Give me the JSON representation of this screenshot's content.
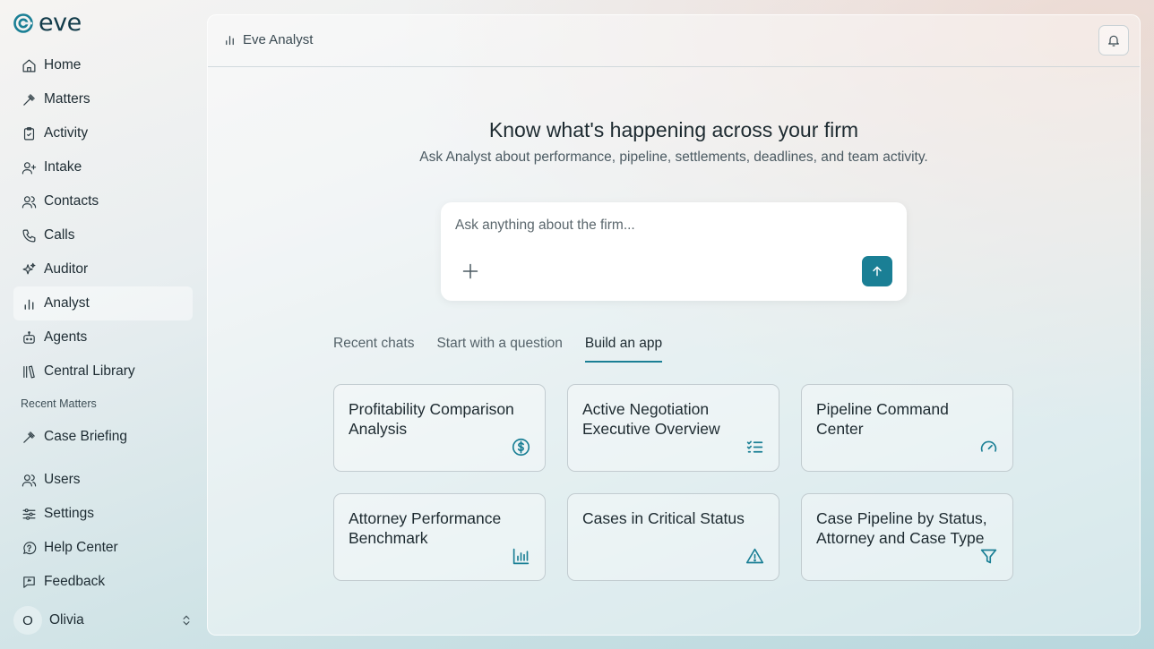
{
  "app": {
    "logo_text": "eve"
  },
  "sidebar": {
    "items": [
      {
        "label": "Home",
        "icon": "home-icon"
      },
      {
        "label": "Matters",
        "icon": "gavel-icon"
      },
      {
        "label": "Activity",
        "icon": "clipboard-check-icon"
      },
      {
        "label": "Intake",
        "icon": "user-plus-icon"
      },
      {
        "label": "Contacts",
        "icon": "users-icon"
      },
      {
        "label": "Calls",
        "icon": "phone-icon"
      },
      {
        "label": "Auditor",
        "icon": "sparkles-icon"
      },
      {
        "label": "Analyst",
        "icon": "bar-chart-icon",
        "active": true
      },
      {
        "label": "Agents",
        "icon": "bot-icon"
      },
      {
        "label": "Central Library",
        "icon": "library-icon"
      }
    ],
    "recent_section_label": "Recent Matters",
    "recent_items": [
      {
        "label": "Case Briefing",
        "icon": "gavel-icon"
      }
    ],
    "bottom_items": [
      {
        "label": "Users",
        "icon": "users-icon"
      },
      {
        "label": "Settings",
        "icon": "sliders-icon"
      },
      {
        "label": "Help Center",
        "icon": "help-circle-icon"
      },
      {
        "label": "Feedback",
        "icon": "feedback-icon"
      }
    ],
    "user": {
      "initial": "O",
      "name": "Olivia"
    }
  },
  "header": {
    "title": "Eve Analyst"
  },
  "hero": {
    "title": "Know what's happening across your firm",
    "subtitle": "Ask Analyst about performance, pipeline, settlements, deadlines, and team activity."
  },
  "prompt": {
    "placeholder": "Ask anything about the firm...",
    "value": ""
  },
  "tabs": [
    {
      "label": "Recent chats",
      "active": false
    },
    {
      "label": "Start with a question",
      "active": false
    },
    {
      "label": "Build an app",
      "active": true
    }
  ],
  "cards": [
    {
      "title": "Profitability Comparison Analysis",
      "icon": "dollar-circle-icon"
    },
    {
      "title": "Active Negotiation Executive Overview",
      "icon": "checklist-icon"
    },
    {
      "title": "Pipeline Command Center",
      "icon": "gauge-icon"
    },
    {
      "title": "Attorney Performance Benchmark",
      "icon": "bar-chart-icon"
    },
    {
      "title": "Cases in Critical Status",
      "icon": "alert-triangle-icon"
    },
    {
      "title": "Case Pipeline by Status, Attorney and Case Type",
      "icon": "filter-icon"
    }
  ],
  "colors": {
    "accent": "#1a7f95",
    "text": "#1d2a30",
    "logo": "#123b4a"
  }
}
